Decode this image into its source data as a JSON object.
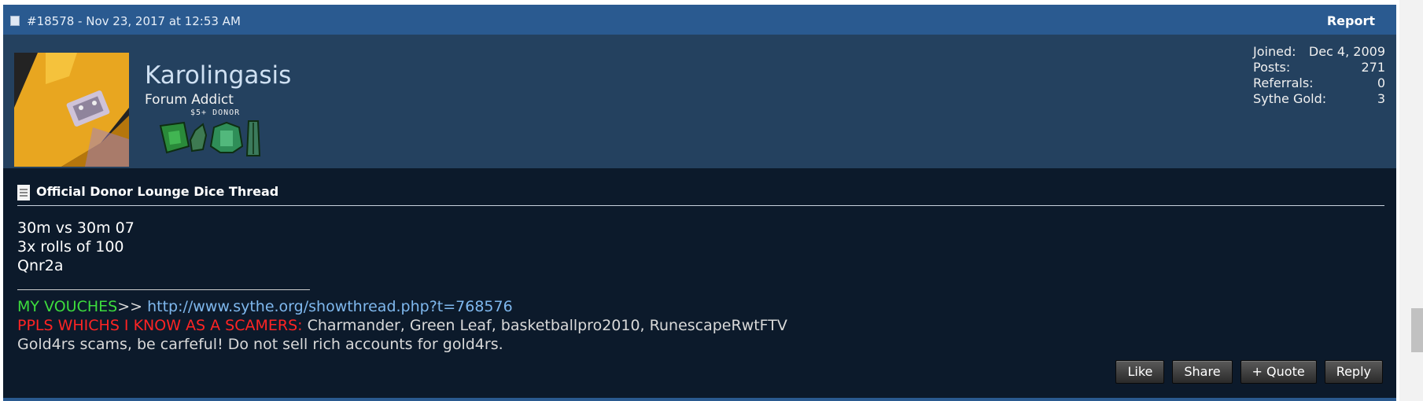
{
  "header": {
    "post_meta": "#18578 - Nov 23, 2017 at 12:53 AM",
    "report_label": "Report"
  },
  "user": {
    "name": "Karolingasis",
    "title": "Forum Addict",
    "donor_label": "$5+ DONOR"
  },
  "stats": [
    {
      "label": "Joined:",
      "value": "Dec 4, 2009"
    },
    {
      "label": "Posts:",
      "value": "271"
    },
    {
      "label": "Referrals:",
      "value": "0"
    },
    {
      "label": "Sythe Gold:",
      "value": "3"
    }
  ],
  "thread": {
    "title": "Official Donor Lounge Dice Thread"
  },
  "body": {
    "lines": [
      "30m vs 30m 07",
      "3x rolls of 100",
      "Qnr2a"
    ]
  },
  "signature": {
    "separator": "________________________",
    "vouches_label": "MY VOUCHES",
    "vouches_arrow": ">> ",
    "vouches_link": "http://www.sythe.org/showthread.php?t=768576",
    "scammers_label": "PPLS WHICHS I KNOW AS A SCAMERS:",
    "scammers_list": " Charmander, Green Leaf, basketballpro2010, RunescapeRwtFTV",
    "warning": "Gold4rs scams, be carfeful! Do not sell rich accounts for gold4rs."
  },
  "buttons": {
    "like": "Like",
    "share": "Share",
    "quote": "+ Quote",
    "reply": "Reply"
  },
  "colors": {
    "header_bg": "#2a5a90",
    "userbar_bg": "#24415f",
    "post_bg": "#0c1a2b",
    "vouches_green": "#3ddc3d",
    "scammers_red": "#ff2424",
    "link_blue": "#7fb8ee"
  }
}
